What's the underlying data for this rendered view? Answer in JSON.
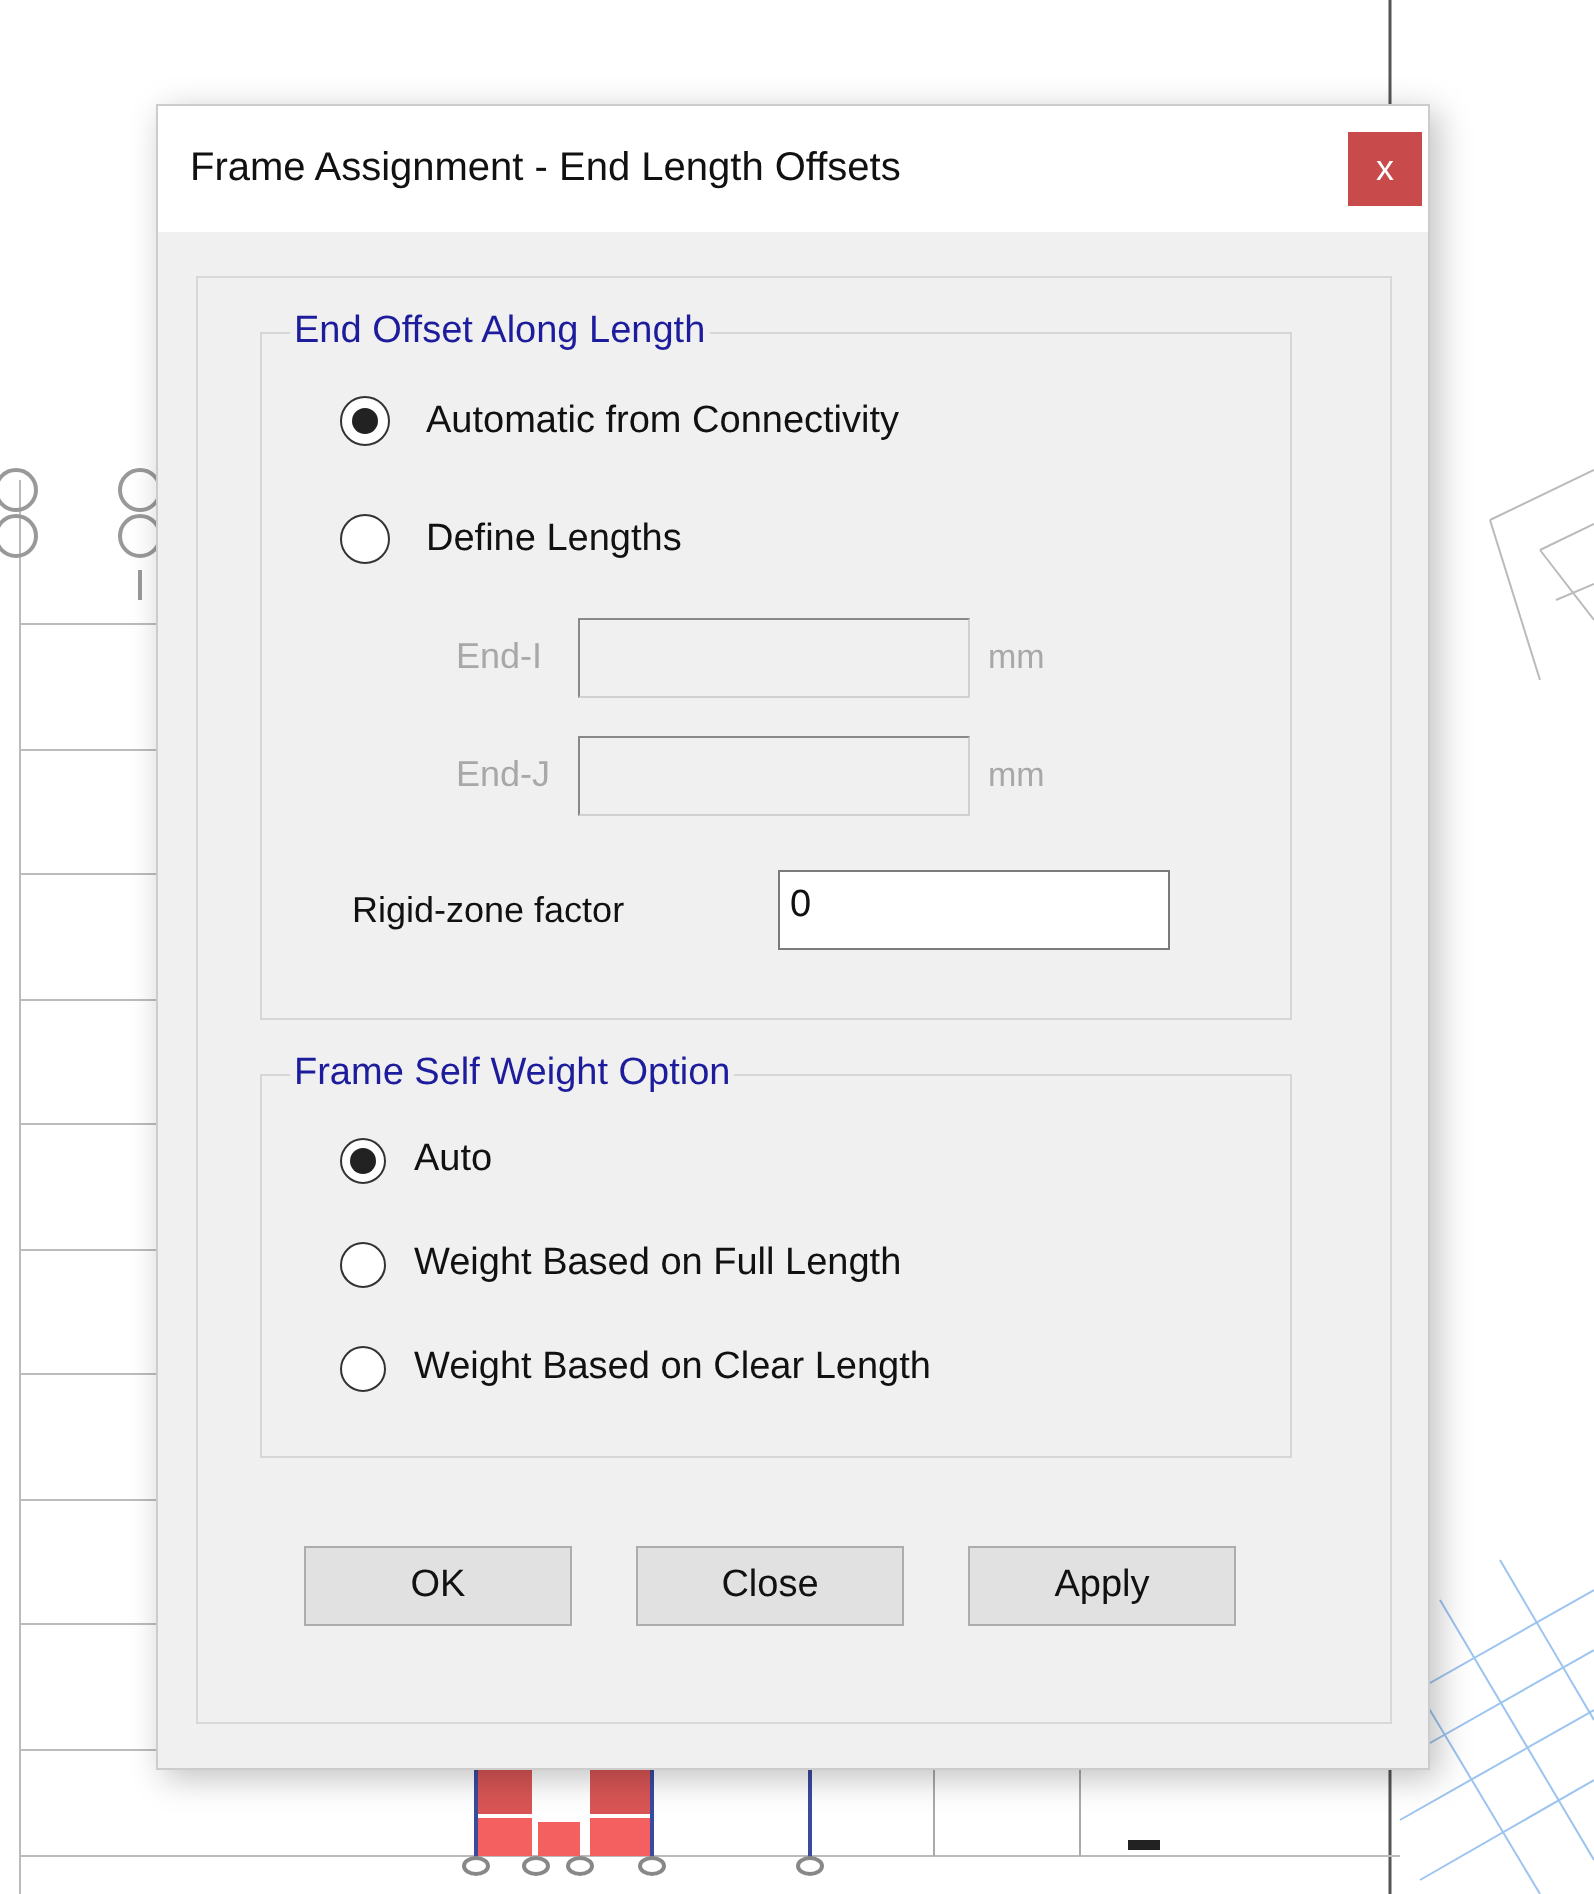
{
  "window": {
    "title": "Frame Assignment - End Length Offsets",
    "close": "x"
  },
  "end_offset": {
    "legend": "End Offset Along Length",
    "options": [
      {
        "label": "Automatic from Connectivity",
        "selected": true
      },
      {
        "label": "Define Lengths",
        "selected": false
      }
    ],
    "lengths": [
      {
        "label": "End-I",
        "unit": "mm",
        "disabled": true
      },
      {
        "label": "End-J",
        "unit": "mm",
        "disabled": true
      }
    ],
    "rigid_zone": {
      "label": "Rigid-zone factor",
      "value": "0"
    }
  },
  "self_weight": {
    "legend": "Frame Self Weight Option",
    "options": [
      {
        "label": "Auto",
        "selected": true
      },
      {
        "label": "Weight Based on Full Length",
        "selected": false
      },
      {
        "label": "Weight Based on Clear Length",
        "selected": false
      }
    ]
  },
  "buttons": [
    "OK",
    "Close",
    "Apply"
  ]
}
